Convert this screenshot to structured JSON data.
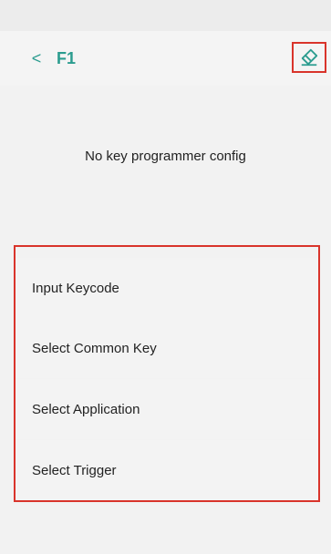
{
  "header": {
    "back_glyph": "<",
    "title": "F1",
    "erase_icon": "eraser-icon"
  },
  "main": {
    "message": "No key programmer config"
  },
  "menu": {
    "items": [
      {
        "label": "Input Keycode"
      },
      {
        "label": "Select Common Key"
      },
      {
        "label": "Select Application"
      },
      {
        "label": "Select Trigger"
      }
    ]
  },
  "colors": {
    "accent": "#2b9c8f",
    "highlight": "#d9342b",
    "background": "#f2f2f2"
  }
}
